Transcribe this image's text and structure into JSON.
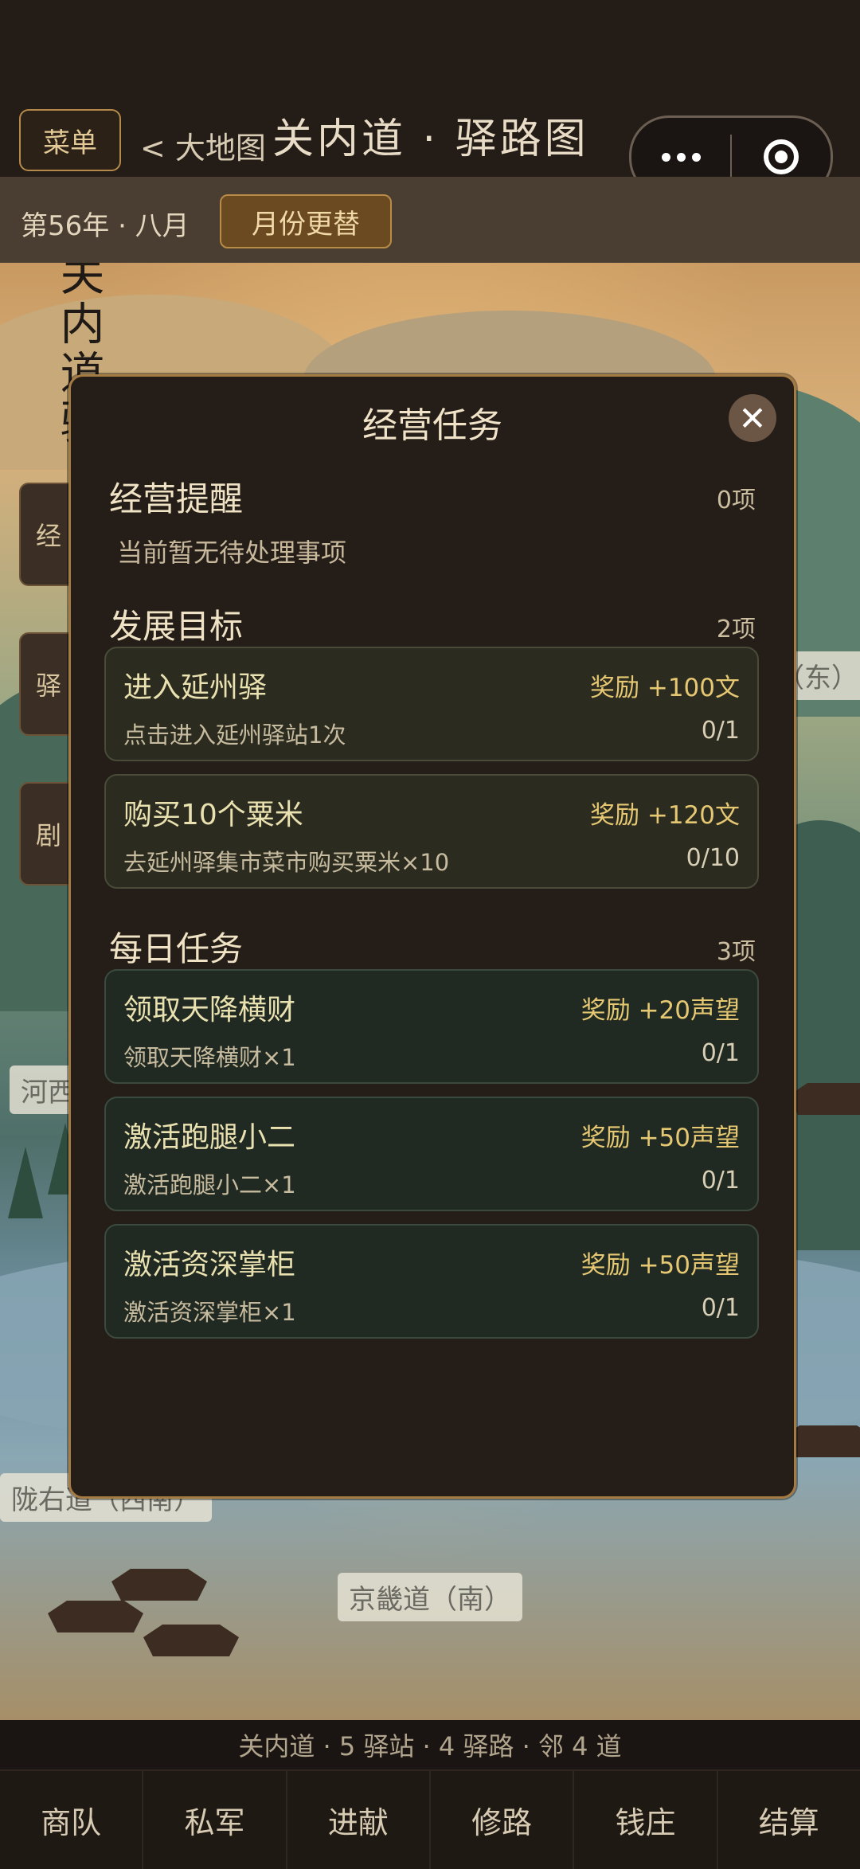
{
  "header": {
    "menu_label": "菜单",
    "back_label": "< 大地图",
    "title": "关内道 · 驿路图"
  },
  "status": {
    "date": "第56年 · 八月",
    "month_button": "月份更替"
  },
  "map": {
    "vertical_title": "关内道驿",
    "side_tabs": [
      "经",
      "驿",
      "剧"
    ],
    "labels": [
      "（东）",
      "河西",
      "陇右道（西南）",
      "京畿道（南）"
    ]
  },
  "modal": {
    "title": "经营任务",
    "close_icon": "close-icon",
    "reminders": {
      "title": "经营提醒",
      "count": "0项",
      "empty_text": "当前暂无待处理事项"
    },
    "goals": {
      "title": "发展目标",
      "count": "2项",
      "tasks": [
        {
          "name": "进入延州驿",
          "reward": "奖励 +100文",
          "desc": "点击进入延州驿站1次",
          "progress": "0/1"
        },
        {
          "name": "购买10个粟米",
          "reward": "奖励 +120文",
          "desc": "去延州驿集市菜市购买粟米×10",
          "progress": "0/10"
        }
      ]
    },
    "daily": {
      "title": "每日任务",
      "count": "3项",
      "tasks": [
        {
          "name": "领取天降横财",
          "reward": "奖励 +20声望",
          "desc": "领取天降横财×1",
          "progress": "0/1"
        },
        {
          "name": "激活跑腿小二",
          "reward": "奖励 +50声望",
          "desc": "激活跑腿小二×1",
          "progress": "0/1"
        },
        {
          "name": "激活资深掌柜",
          "reward": "奖励 +50声望",
          "desc": "激活资深掌柜×1",
          "progress": "0/1"
        }
      ]
    }
  },
  "footer": {
    "stats": "关内道 · 5 驿站 · 4 驿路 · 邻 4 道",
    "nav": [
      "商队",
      "私军",
      "进献",
      "修路",
      "钱庄",
      "结算"
    ]
  },
  "colors": {
    "accent_gold": "#b5894a",
    "reward": "#e6c873",
    "modal_bg": "#241d18"
  }
}
